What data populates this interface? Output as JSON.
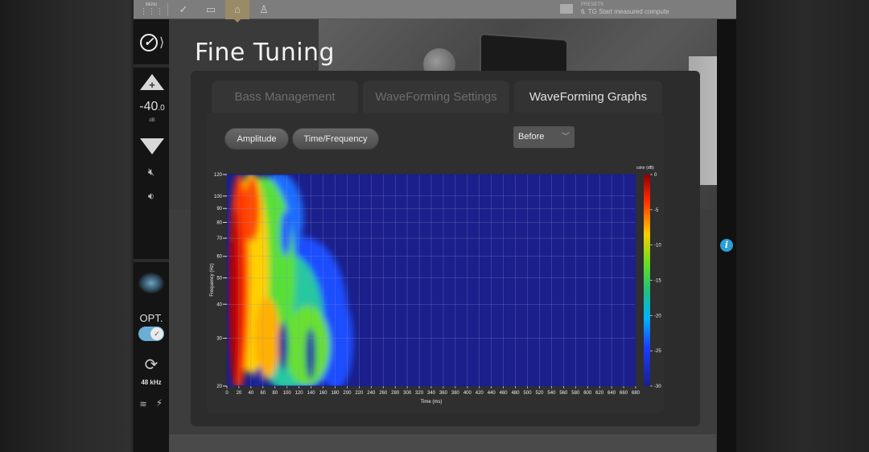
{
  "toolbar": {
    "menu_label": "MENU",
    "presets_label": "PRESETS",
    "preset_name": "6. TG Start measured compute"
  },
  "sidebar": {
    "volume_value": "-40",
    "volume_decimal": ".0",
    "volume_unit": "dB",
    "opt_label": "OPT.",
    "sample_rate": "48 kHz"
  },
  "page": {
    "title": "Fine Tuning"
  },
  "tabs": [
    {
      "label": "Bass Management",
      "active": false
    },
    {
      "label": "WaveForming Settings",
      "active": false
    },
    {
      "label": "WaveForming Graphs",
      "active": true
    }
  ],
  "buttons": {
    "amplitude": "Amplitude",
    "time_frequency": "Time/Frequency"
  },
  "dropdown": {
    "selected": "Before"
  },
  "colors": {
    "accent": "#6aaed6",
    "info": "#2a9fd6",
    "plot_bg": "#1a1f8c"
  },
  "chart_data": {
    "type": "heatmap",
    "title": "",
    "xlabel": "Time (ms)",
    "ylabel": "Frequency (Hz)",
    "x_ticks": [
      0,
      20,
      40,
      60,
      80,
      100,
      120,
      140,
      160,
      180,
      200,
      220,
      240,
      260,
      280,
      300,
      320,
      340,
      360,
      380,
      400,
      420,
      440,
      460,
      480,
      500,
      520,
      540,
      560,
      580,
      600,
      620,
      640,
      660,
      680
    ],
    "xlim": [
      0,
      680
    ],
    "y_scale": "log",
    "y_ticks": [
      20,
      30,
      40,
      50,
      60,
      70,
      80,
      90,
      100,
      120
    ],
    "ylim": [
      20,
      120
    ],
    "colorbar": {
      "label": "color (dB)",
      "ticks": [
        0,
        -5,
        -10,
        -15,
        -20,
        -25,
        -30
      ],
      "range": [
        -30,
        0
      ]
    },
    "grid": true
  }
}
